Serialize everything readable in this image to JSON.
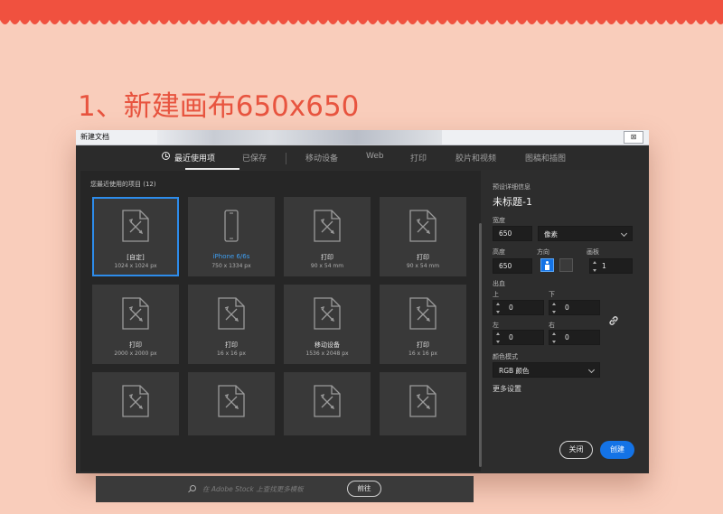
{
  "page": {
    "heading": "1、新建画布650x650"
  },
  "dialog": {
    "title": "新建文档",
    "close_label": "⊠",
    "tabs": [
      {
        "label": "最近使用项",
        "active": true
      },
      {
        "label": "已保存"
      },
      {
        "label": "移动设备"
      },
      {
        "label": "Web"
      },
      {
        "label": "打印"
      },
      {
        "label": "胶片和视频"
      },
      {
        "label": "图稿和插图"
      }
    ],
    "recent": {
      "title": "您最近使用的项目 (12)",
      "items": [
        {
          "name": "[自定]",
          "dims": "1024 x 1024 px",
          "icon": "document-icon",
          "selected": true
        },
        {
          "name": "iPhone 6/6s",
          "dims": "750 x 1334 px",
          "icon": "phone-icon",
          "blue": true
        },
        {
          "name": "打印",
          "dims": "90 x 54 mm",
          "icon": "document-icon"
        },
        {
          "name": "打印",
          "dims": "90 x 54 mm",
          "icon": "document-icon"
        },
        {
          "name": "打印",
          "dims": "2000 x 2000 px",
          "icon": "document-icon"
        },
        {
          "name": "打印",
          "dims": "16 x 16 px",
          "icon": "document-icon"
        },
        {
          "name": "移动设备",
          "dims": "1536 x 2048 px",
          "icon": "document-icon"
        },
        {
          "name": "打印",
          "dims": "16 x 16 px",
          "icon": "document-icon"
        },
        {
          "name": "",
          "dims": "",
          "icon": "document-icon"
        },
        {
          "name": "",
          "dims": "",
          "icon": "document-icon"
        },
        {
          "name": "",
          "dims": "",
          "icon": "document-icon"
        },
        {
          "name": "",
          "dims": "",
          "icon": "document-icon"
        }
      ]
    },
    "search": {
      "placeholder": "在 Adobe Stock 上查找更多模板",
      "go_label": "前往"
    },
    "preset": {
      "section_title": "预设详细信息",
      "doc_name": "未标题-1",
      "width_label": "宽度",
      "width_value": "650",
      "unit_value": "像素",
      "height_label": "高度",
      "height_value": "650",
      "orientation_label": "方向",
      "artboard_label": "画板",
      "artboard_value": "1",
      "bleed_label": "出血",
      "top_label": "上",
      "top_value": "0",
      "bottom_label": "下",
      "bottom_value": "0",
      "left_label": "左",
      "left_value": "0",
      "right_label": "右",
      "right_value": "0",
      "color_mode_label": "颜色模式",
      "color_mode_value": "RGB 颜色",
      "more_settings": "更多设置"
    },
    "buttons": {
      "close": "关闭",
      "create": "创建"
    }
  }
}
